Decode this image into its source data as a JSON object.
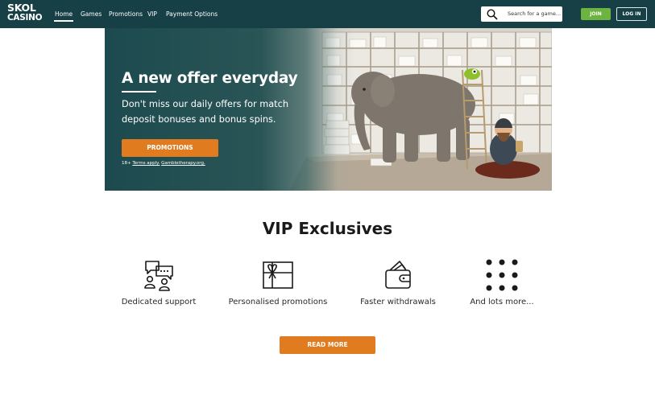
{
  "brand": {
    "logo_line1": "SKOL",
    "logo_line2": "CASINO"
  },
  "nav": {
    "items": [
      {
        "label": "Home",
        "active": true
      },
      {
        "label": "Games"
      },
      {
        "label": "Promotions"
      },
      {
        "label": "VIP"
      },
      {
        "label": "Payment Options"
      }
    ]
  },
  "search": {
    "placeholder": "Search for a game..."
  },
  "auth": {
    "join_label": "JOIN",
    "login_label": "LOG IN"
  },
  "hero": {
    "title": "A new offer everyday",
    "subtitle": "Don't miss our daily offers for match deposit bonuses and bonus spins.",
    "button_label": "PROMOTIONS",
    "terms_prefix": "18+ ",
    "terms_link": "Terms apply.",
    "terms_link2": "Gambletherapy.org."
  },
  "vip": {
    "title": "VIP Exclusives",
    "features": [
      {
        "label": "Dedicated support",
        "icon": "support-chat-icon"
      },
      {
        "label": "Personalised promotions",
        "icon": "gift-icon"
      },
      {
        "label": "Faster withdrawals",
        "icon": "wallet-icon"
      },
      {
        "label": "And lots more...",
        "icon": "dots-grid-icon"
      }
    ],
    "read_more_label": "READ MORE"
  },
  "colors": {
    "header_bg": "#173f46",
    "join_green": "#6cb33f",
    "cta_orange": "#e07b20",
    "hero_teal": "#1c4a4e"
  }
}
